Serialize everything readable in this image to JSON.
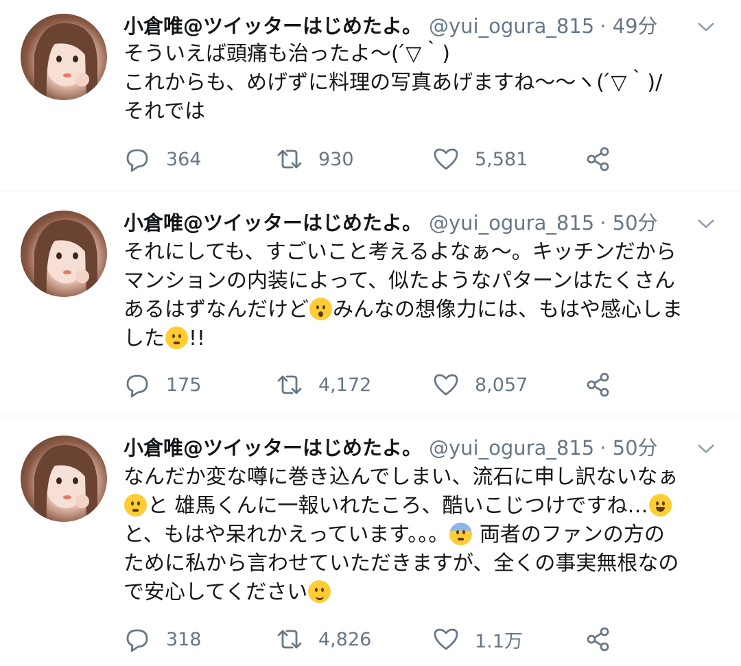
{
  "tweets": [
    {
      "name": "小倉唯@ツイッターはじめたよ。",
      "handle": "@yui_ogura_815",
      "time": "· 49分",
      "lines": [
        "そういえば頭痛も治ったよ〜( ́▽｀)",
        "これからも、めげずに料理の写真あげますね〜〜ヽ( ́▽｀)/",
        "それでは"
      ],
      "replies": "364",
      "retweets": "930",
      "likes": "5,581"
    },
    {
      "name": "小倉唯@ツイッターはじめたよ。",
      "handle": "@yui_ogura_815",
      "time": "· 50分",
      "lines": [
        "それにしても、すごいこと考えるよなぁ〜。キッチンだから",
        "マンションの内装によって、似たようなパターンはたくさん",
        "あるはずなんだけど",
        "みんなの想像力には、もはや感心しま",
        "した",
        "!!"
      ],
      "replies": "175",
      "retweets": "4,172",
      "likes": "8,057"
    },
    {
      "name": "小倉唯@ツイッターはじめたよ。",
      "handle": "@yui_ogura_815",
      "time": "· 50分",
      "lines": [
        "なんだか変な噂に巻き込んでしまい、流石に申し訳ないなぁ",
        "と 雄馬くんに一報いれたころ、酷いこじつけですね…",
        "と、もはや呆れかえっています。。。",
        " 両者のファンの方の",
        "ために私から言わせていただきますが、全くの事実無根なの",
        "で安心してください"
      ],
      "replies": "318",
      "retweets": "4,826",
      "likes": "1.1万"
    }
  ],
  "icons": {
    "reply": "reply-icon",
    "retweet": "retweet-icon",
    "like": "heart-icon",
    "share": "share-icon",
    "caret": "chevron-down-icon"
  },
  "colors": {
    "text": "#14171a",
    "meta": "#657786",
    "divider": "#e1e8ed"
  }
}
